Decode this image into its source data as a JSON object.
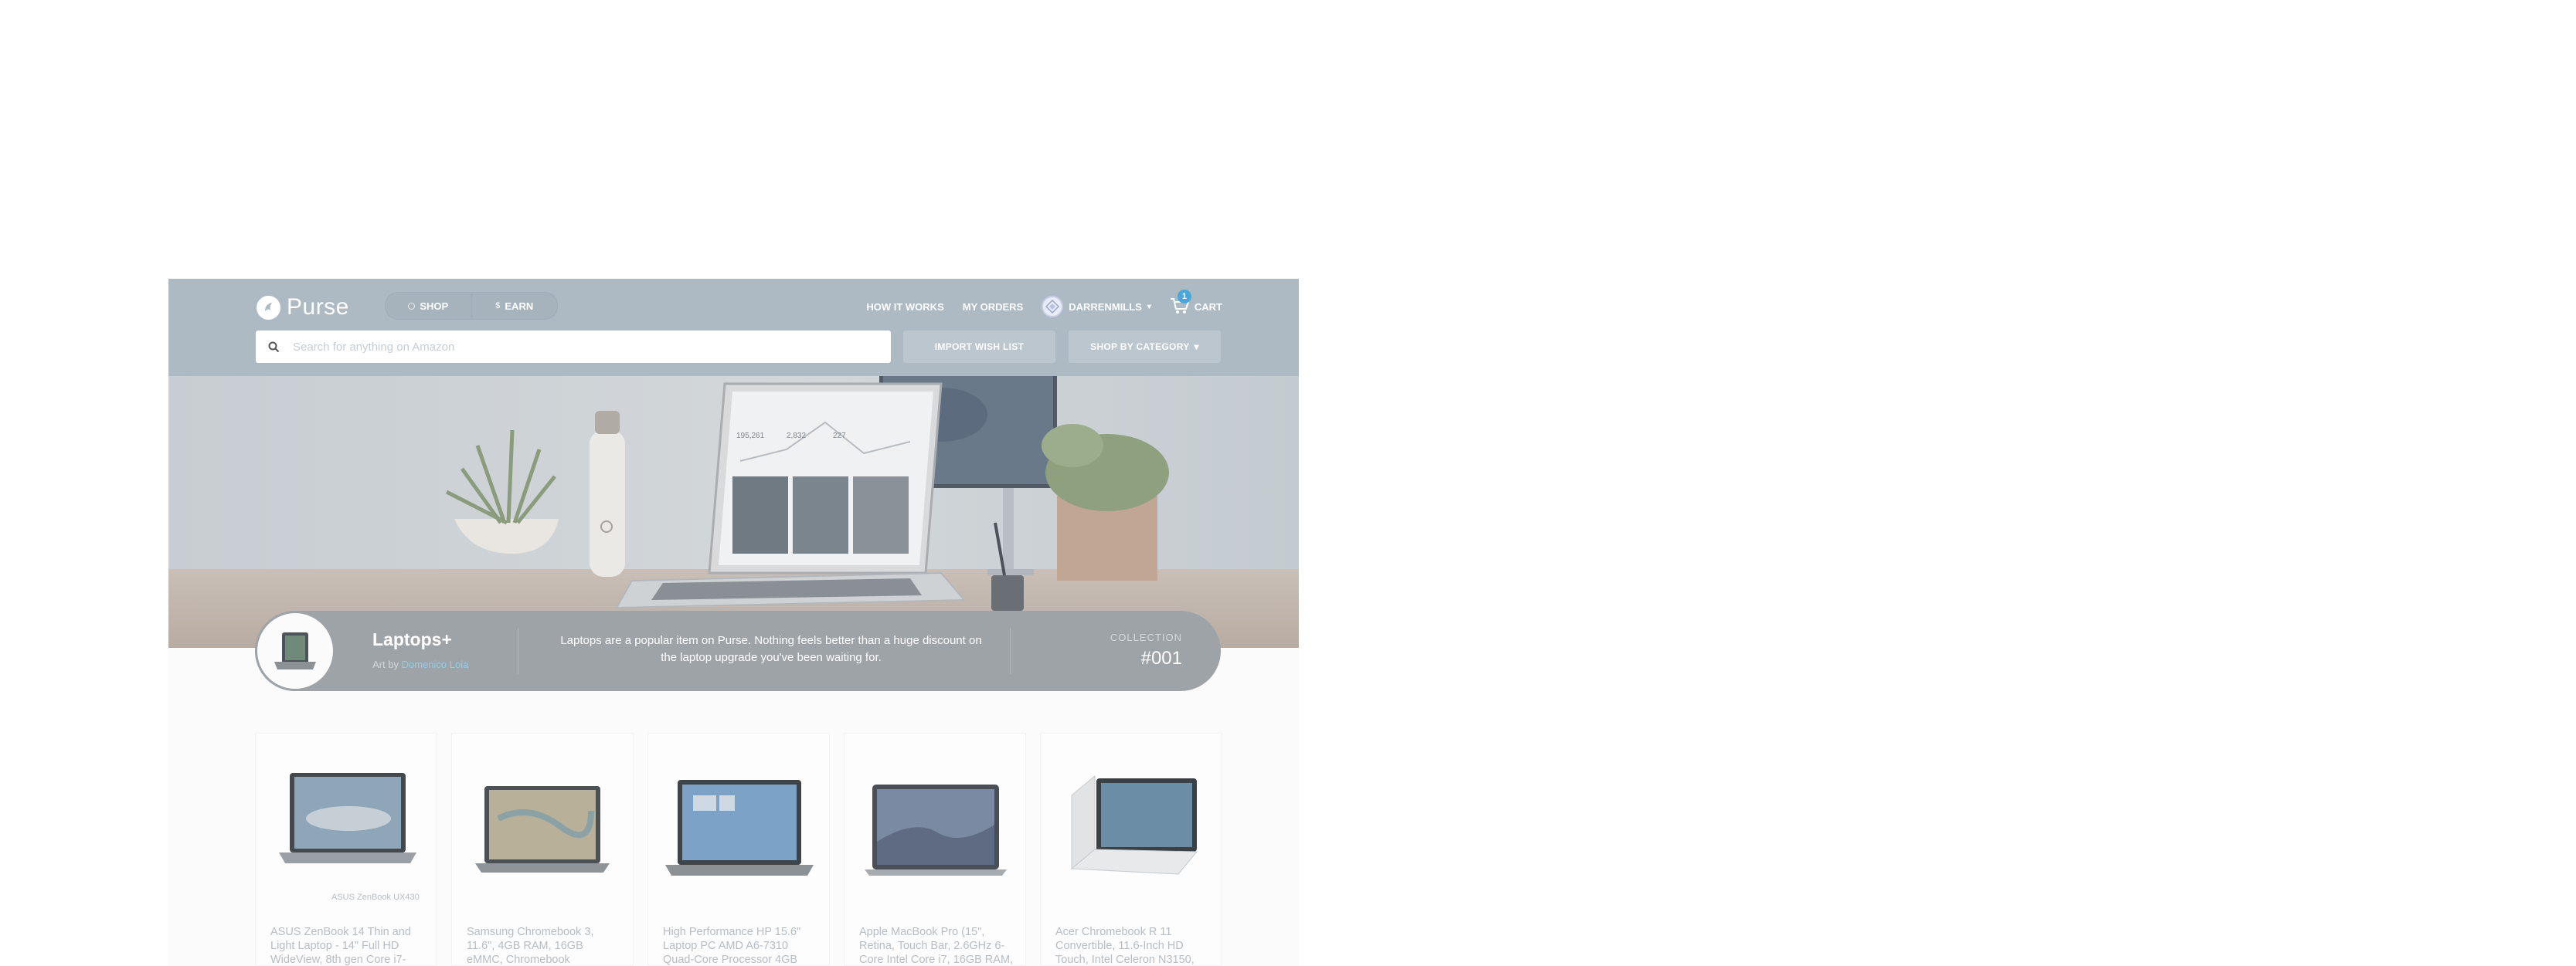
{
  "header": {
    "logo_text": "Purse",
    "nav": {
      "shop_label": "SHOP",
      "earn_label": "EARN"
    },
    "links": {
      "how_it_works": "HOW IT WORKS",
      "my_orders": "MY ORDERS"
    },
    "user": {
      "username": "DARRENMILLS"
    },
    "cart": {
      "label": "CART",
      "count": "1"
    },
    "search": {
      "placeholder": "Search for anything on Amazon"
    },
    "import_wish_list": "IMPORT WISH LIST",
    "shop_by_category": "SHOP BY CATEGORY"
  },
  "hero": {
    "dashboard_stats": [
      "195,261",
      "2,832",
      "227"
    ]
  },
  "collection": {
    "title": "Laptops+",
    "art_prefix": "Art by",
    "artist": "Domenico Loia",
    "description": "Laptops are a popular item on Purse. Nothing feels better than a huge discount on the laptop upgrade you've been waiting for.",
    "label": "COLLECTION",
    "number": "#001"
  },
  "products": [
    {
      "title": "ASUS ZenBook 14 Thin and Light Laptop - 14\" Full HD WideView, 8th gen Core i7-",
      "brand": "ASUS ZenBook UX430"
    },
    {
      "title": "Samsung Chromebook 3, 11.6\", 4GB RAM, 16GB eMMC, Chromebook"
    },
    {
      "title": "High Performance HP 15.6\" Laptop PC AMD A6-7310 Quad-Core Processor 4GB"
    },
    {
      "title": "Apple MacBook Pro (15\", Retina, Touch Bar, 2.6GHz 6-Core Intel Core i7, 16GB RAM,"
    },
    {
      "title": "Acer Chromebook R 11 Convertible, 11.6-Inch HD Touch, Intel Celeron N3150,"
    }
  ],
  "colors": {
    "header_bg": "#adbac4",
    "accent_blue": "#4aa8d8",
    "collection_bar": "#9ea3a8",
    "artist_link": "#8fd0ea"
  },
  "icons": [
    "purse-logo-icon",
    "shop-icon",
    "earn-icon",
    "user-avatar-icon",
    "chevron-down-icon",
    "cart-icon",
    "search-icon"
  ]
}
